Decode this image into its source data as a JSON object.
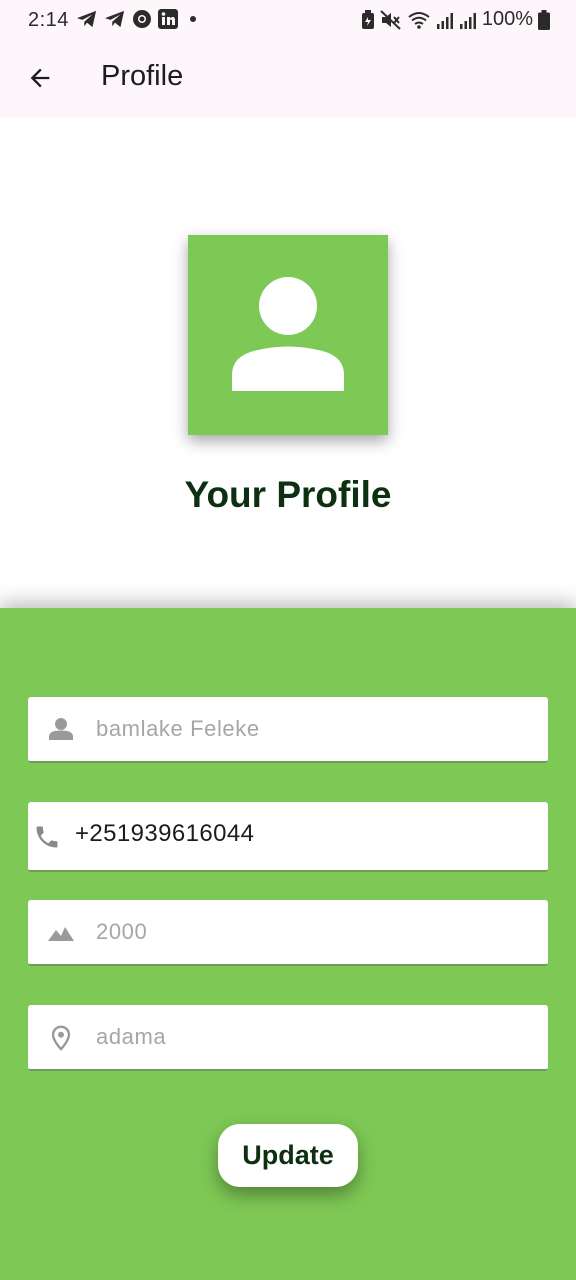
{
  "status_bar": {
    "time": "2:14",
    "battery_percent": "100%",
    "left_icons": [
      "telegram-icon",
      "telegram-icon",
      "chrome-icon",
      "linkedin-icon",
      "dot-icon"
    ],
    "right_icons": [
      "battery-saver-icon",
      "mute-icon",
      "wifi-icon",
      "signal-icon",
      "signal-icon",
      "battery-icon"
    ]
  },
  "appbar": {
    "title": "Profile",
    "back_icon": "arrow-back-icon"
  },
  "header": {
    "avatar_icon": "person-icon",
    "heading": "Your Profile"
  },
  "form": {
    "name": {
      "icon": "person-icon",
      "value": "",
      "placeholder": "bamlake Feleke"
    },
    "phone": {
      "icon": "phone-icon",
      "value": "+251939616044",
      "placeholder": ""
    },
    "field3": {
      "icon": "landscape-icon",
      "value": "",
      "placeholder": "2000"
    },
    "location": {
      "icon": "location-pin-icon",
      "value": "",
      "placeholder": "adama"
    },
    "update_label": "Update"
  },
  "colors": {
    "accent_green": "#7ec855",
    "heading_dark": "#0d3010",
    "appbar_bg": "#fdf7fc",
    "placeholder": "#a6a6a6"
  }
}
